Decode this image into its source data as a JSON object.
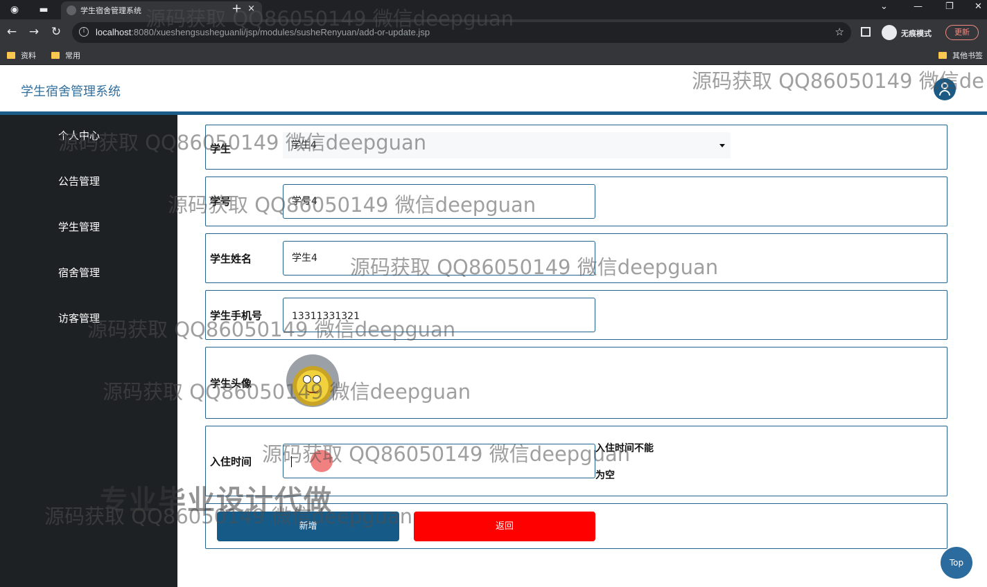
{
  "browser": {
    "tab_title": "学生宿舍管理系统",
    "tab_close": "×",
    "new_tab": "+",
    "url_host": "localhost",
    "url_path": ":8080/xueshengsusheguanli/jsp/modules/susheRenyuan/add-or-update.jsp",
    "incognito_label": "无痕模式",
    "update_label": "更新",
    "bookmarks": [
      "资料",
      "常用"
    ],
    "other_bookmarks": "其他书签"
  },
  "app": {
    "title": "学生宿舍管理系统"
  },
  "sidebar": {
    "items": [
      {
        "label": "个人中心"
      },
      {
        "label": "公告管理"
      },
      {
        "label": "学生管理"
      },
      {
        "label": "宿舍管理"
      },
      {
        "label": "访客管理"
      }
    ]
  },
  "form": {
    "student_label": "学生",
    "student_value": "学生4",
    "student_no_label": "学号",
    "student_no_value": "学号4",
    "name_label": "学生姓名",
    "name_value": "学生4",
    "phone_label": "学生手机号",
    "phone_value": "13311331321",
    "photo_label": "学生头像",
    "checkin_label": "入住时间",
    "checkin_value": "",
    "checkin_error_line1": "入住时间不能",
    "checkin_error_line2": "为空",
    "add_button": "新增",
    "back_button": "返回"
  },
  "top_button": "Top",
  "watermarks": {
    "text": "源码获取 QQ86050149 微信deepguan",
    "header_text": "源码获取 QQ86050149 微信de",
    "big_text": "专业毕业设计代做"
  }
}
